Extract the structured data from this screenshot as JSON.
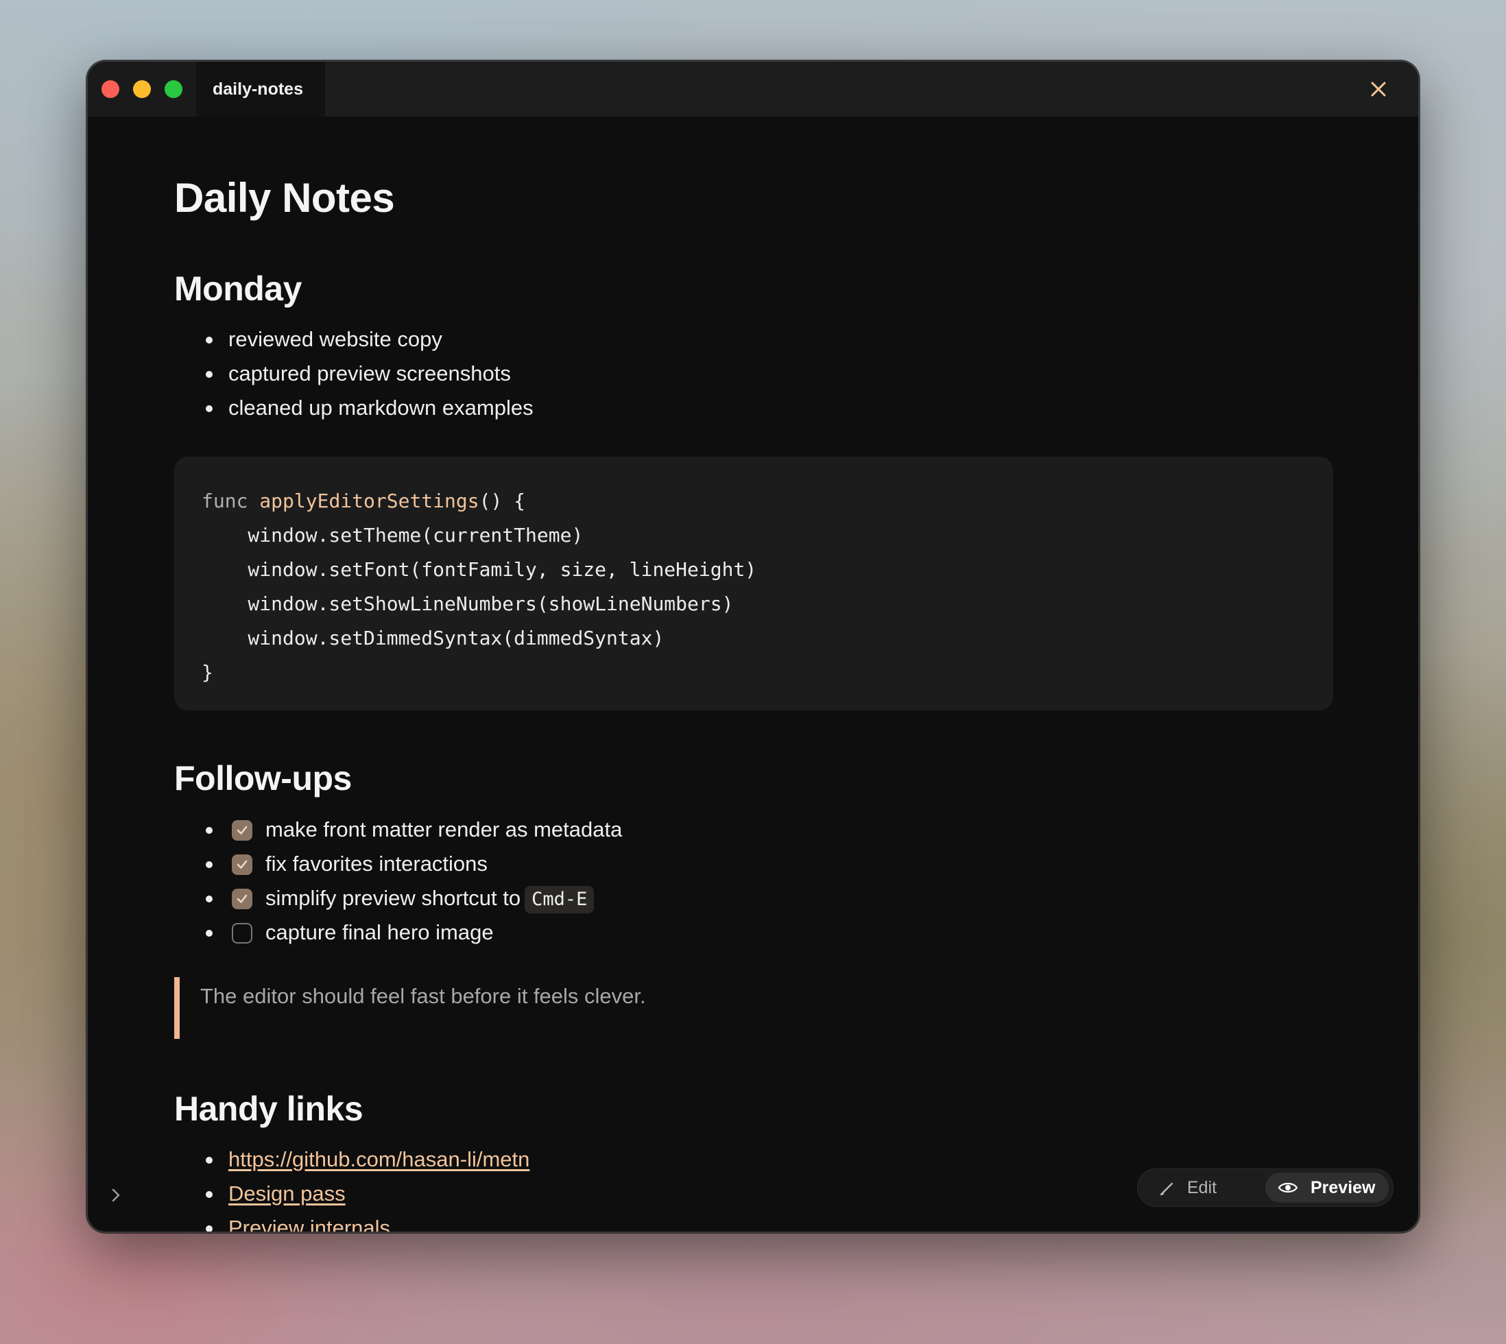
{
  "window": {
    "tab_title": "daily-notes"
  },
  "document": {
    "title": "Daily Notes",
    "sections": {
      "monday": {
        "heading": "Monday",
        "items": [
          "reviewed website copy",
          "captured preview screenshots",
          "cleaned up markdown examples"
        ]
      },
      "code": {
        "line1_keyword": "func",
        "line1_function": "applyEditorSettings",
        "line1_rest": "() {",
        "line2": "    window.setTheme(currentTheme)",
        "line3": "    window.setFont(fontFamily, size, lineHeight)",
        "line4": "    window.setShowLineNumbers(showLineNumbers)",
        "line5": "    window.setDimmedSyntax(dimmedSyntax)",
        "line6": "}"
      },
      "followups": {
        "heading": "Follow-ups",
        "items": [
          {
            "text": "make front matter render as metadata",
            "checked": true
          },
          {
            "text": "fix favorites interactions",
            "checked": true
          },
          {
            "text": "simplify preview shortcut to",
            "checked": true,
            "code": "Cmd-E"
          },
          {
            "text": "capture final hero image",
            "checked": false
          }
        ]
      },
      "quote": "The editor should feel fast before it feels clever.",
      "links": {
        "heading": "Handy links",
        "items": [
          "https://github.com/hasan-li/metn",
          "Design pass",
          "Preview internals"
        ]
      }
    }
  },
  "mode_switch": {
    "edit_label": "Edit",
    "preview_label": "Preview",
    "active": "Preview"
  },
  "colors": {
    "accent": "#f3c49a",
    "quote_bar": "#f0b692",
    "checkbox": "#8b7462",
    "background": "#0e0e0f"
  }
}
